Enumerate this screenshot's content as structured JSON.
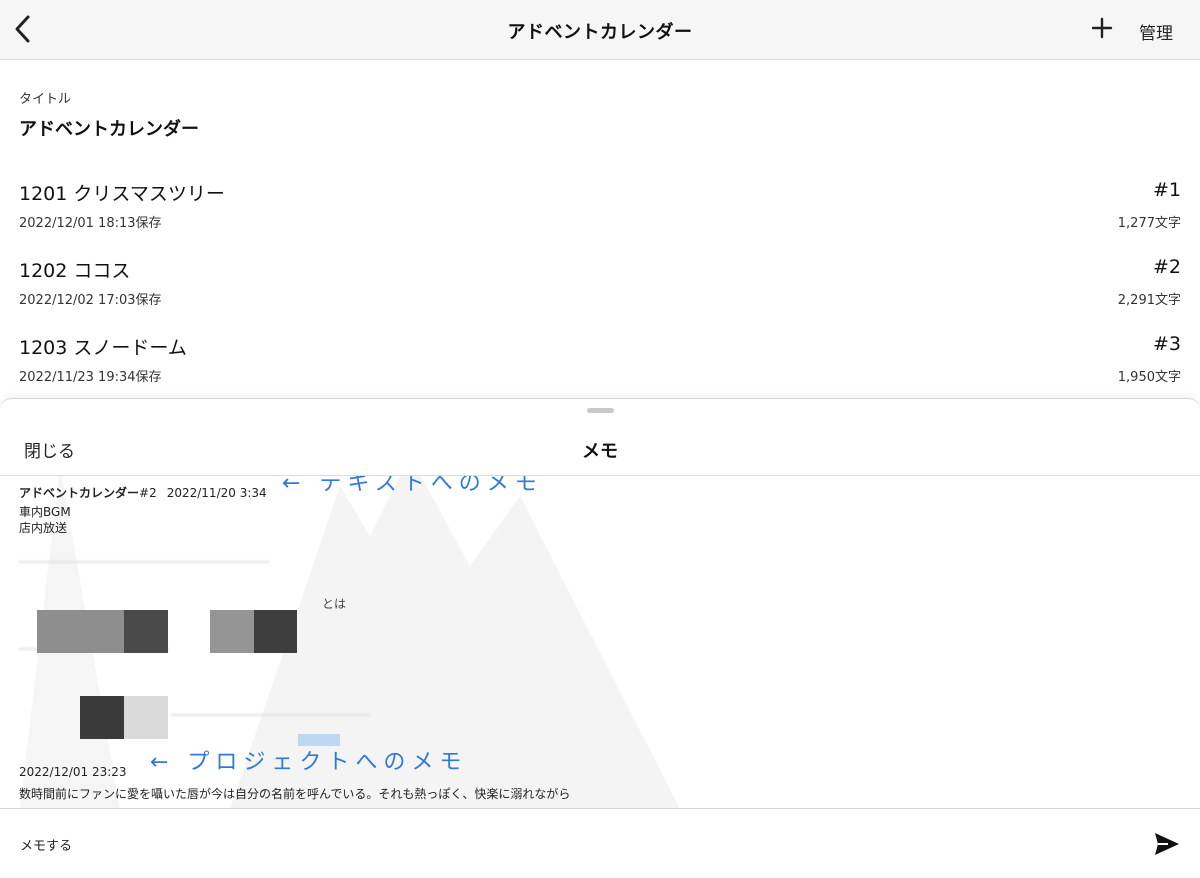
{
  "navbar": {
    "title": "アドベントカレンダー",
    "manage_label": "管理"
  },
  "work": {
    "title_label": "タイトル",
    "title_value": "アドベントカレンダー"
  },
  "episodes": [
    {
      "name": "1201 クリスマスツリー",
      "number": "#1",
      "saved": "2022/12/01 18:13保存",
      "count": "1,277文字"
    },
    {
      "name": "1202 ココス",
      "number": "#2",
      "saved": "2022/12/02 17:03保存",
      "count": "2,291文字"
    },
    {
      "name": "1203 スノードーム",
      "number": "#3",
      "saved": "2022/11/23 19:34保存",
      "count": "1,950文字"
    }
  ],
  "memo_sheet": {
    "close_label": "閉じる",
    "title": "メモ",
    "memos": [
      {
        "source": "アドベントカレンダー",
        "episode": "#2",
        "timestamp": "2022/11/20 3:34",
        "lines": [
          "車内BGM",
          "店内放送"
        ]
      },
      {
        "fragment": "とは"
      },
      {
        "timestamp": "2022/12/01 23:23",
        "text": "数時間前にファンに愛を囁いた唇が今は自分の名前を呼んでいる。それも熱っぽく、快楽に溺れながら"
      }
    ],
    "annotations": {
      "text_memo": "← テキストへのメモ",
      "project_memo": "← プロジェクトへのメモ"
    },
    "input_placeholder": "メモする"
  },
  "colors": {
    "navbar_bg": "#f6f6f6",
    "annotation_blue": "#2f7ad6"
  },
  "icons": {
    "back": "chevron-left-icon",
    "add": "plus-icon",
    "send": "paper-plane-icon"
  }
}
